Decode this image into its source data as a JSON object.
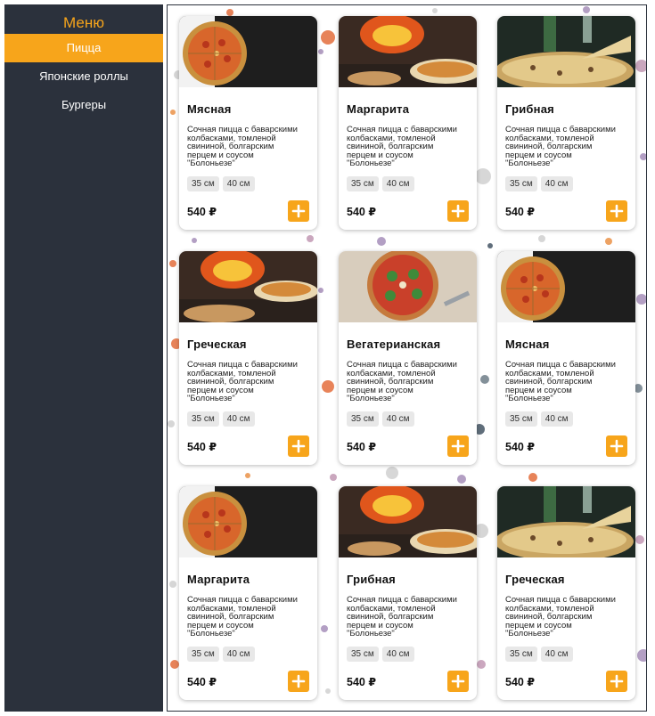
{
  "sidebar": {
    "title": "Меню",
    "items": [
      {
        "label": "Пицца",
        "active": true
      },
      {
        "label": "Японские роллы",
        "active": false
      },
      {
        "label": "Бургеры",
        "active": false
      }
    ]
  },
  "colors": {
    "accent": "#f7a51b",
    "sidebar_bg": "#2b313c",
    "chip_bg": "#e8e8e8"
  },
  "products": [
    {
      "name": "Мясная",
      "image": "pizza-top-view",
      "desc_lines": [
        "Сочная пицца с баварскими",
        "колбасками, томленой",
        "свининой, болгарским",
        "перцем и соусом",
        "\"Болоньезе\""
      ],
      "sizes": [
        "35 см",
        "40 см"
      ],
      "price": "540 ₽"
    },
    {
      "name": "Маргарита",
      "image": "pizza-oven",
      "desc_lines": [
        "Сочная пицца с баварскими",
        "колбасками, томленой",
        "свининой, болгарским",
        "перцем и соусом",
        "\"Болоньезе\""
      ],
      "sizes": [
        "35 см",
        "40 см"
      ],
      "price": "540 ₽"
    },
    {
      "name": "Грибная",
      "image": "pizza-slice-wine",
      "desc_lines": [
        "Сочная пицца с баварскими",
        "колбасками, томленой",
        "свининой, болгарским",
        "перцем и соусом",
        "\"Болоньезе\""
      ],
      "sizes": [
        "35 см",
        "40 см"
      ],
      "price": "540 ₽"
    },
    {
      "name": "Греческая",
      "image": "pizza-oven",
      "desc_lines": [
        "Сочная пицца с баварскими",
        "колбасками, томленой",
        "свининой, болгарским",
        "перцем и соусом",
        "\"Болоньезе\""
      ],
      "sizes": [
        "35 см",
        "40 см"
      ],
      "price": "540 ₽"
    },
    {
      "name": "Вегатерианская",
      "image": "pizza-greens",
      "desc_lines": [
        "Сочная пицца с баварскими",
        "колбасками, томленой",
        "свининой, болгарским",
        "перцем и соусом",
        "\"Болоньезе\""
      ],
      "sizes": [
        "35 см",
        "40 см"
      ],
      "price": "540 ₽"
    },
    {
      "name": "Мясная",
      "image": "pizza-top-view",
      "desc_lines": [
        "Сочная пицца с баварскими",
        "колбасками, томленой",
        "свининой, болгарским",
        "перцем и соусом",
        "\"Болоньезе\""
      ],
      "sizes": [
        "35 см",
        "40 см"
      ],
      "price": "540 ₽"
    },
    {
      "name": "Маргарита",
      "image": "pizza-top-view",
      "desc_lines": [
        "Сочная пицца с баварскими",
        "колбасками, томленой",
        "свининой, болгарским",
        "перцем и соусом",
        "\"Болоньезе\""
      ],
      "sizes": [
        "35 см",
        "40 см"
      ],
      "price": "540 ₽"
    },
    {
      "name": "Грибная",
      "image": "pizza-oven",
      "desc_lines": [
        "Сочная пицца с баварскими",
        "колбасками, томленой",
        "свининой, болгарским",
        "перцем и соусом",
        "\"Болоньезе\""
      ],
      "sizes": [
        "35 см",
        "40 см"
      ],
      "price": "540 ₽"
    },
    {
      "name": "Греческая",
      "image": "pizza-slice-wine",
      "desc_lines": [
        "Сочная пицца с баварскими",
        "колбасками, томленой",
        "свининой, болгарским",
        "перцем и соусом",
        "\"Болоньезе\""
      ],
      "sizes": [
        "35 см",
        "40 см"
      ],
      "price": "540 ₽"
    }
  ]
}
